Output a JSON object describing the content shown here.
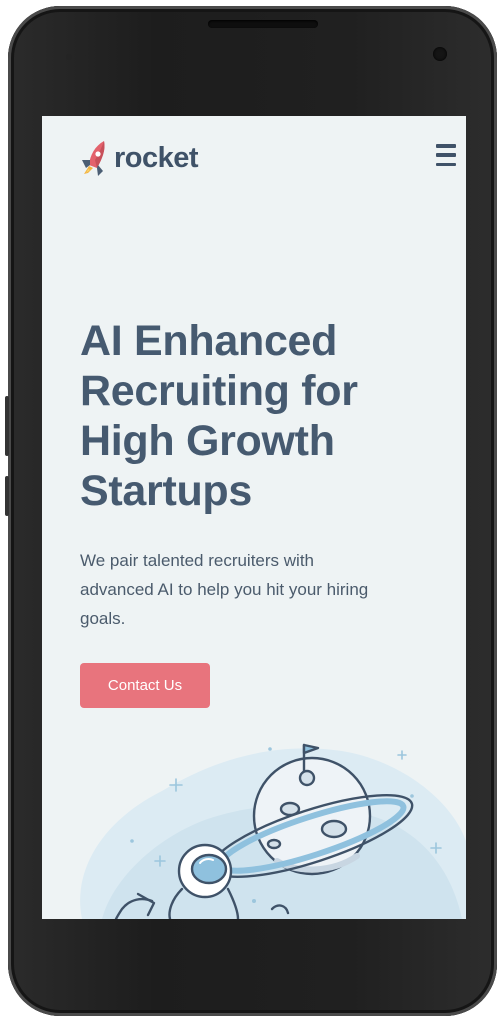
{
  "brand": {
    "name": "rocket"
  },
  "hero": {
    "title_lines": [
      "AI Enhanced",
      "Recruiting for",
      "High Growth",
      "Startups"
    ],
    "subtitle": "We pair talented recruiters with advanced AI to help you hit your hiring goals.",
    "cta_label": "Contact Us"
  },
  "icons": {
    "logo": "rocket-icon",
    "menu": "hamburger-menu-icon",
    "illustration": "astronaut-planet-illustration"
  },
  "colors": {
    "background": "#eef3f4",
    "heading": "#465a70",
    "body_text": "#4b5b6c",
    "cta": "#e8747d",
    "logo_text": "#3f5268"
  }
}
